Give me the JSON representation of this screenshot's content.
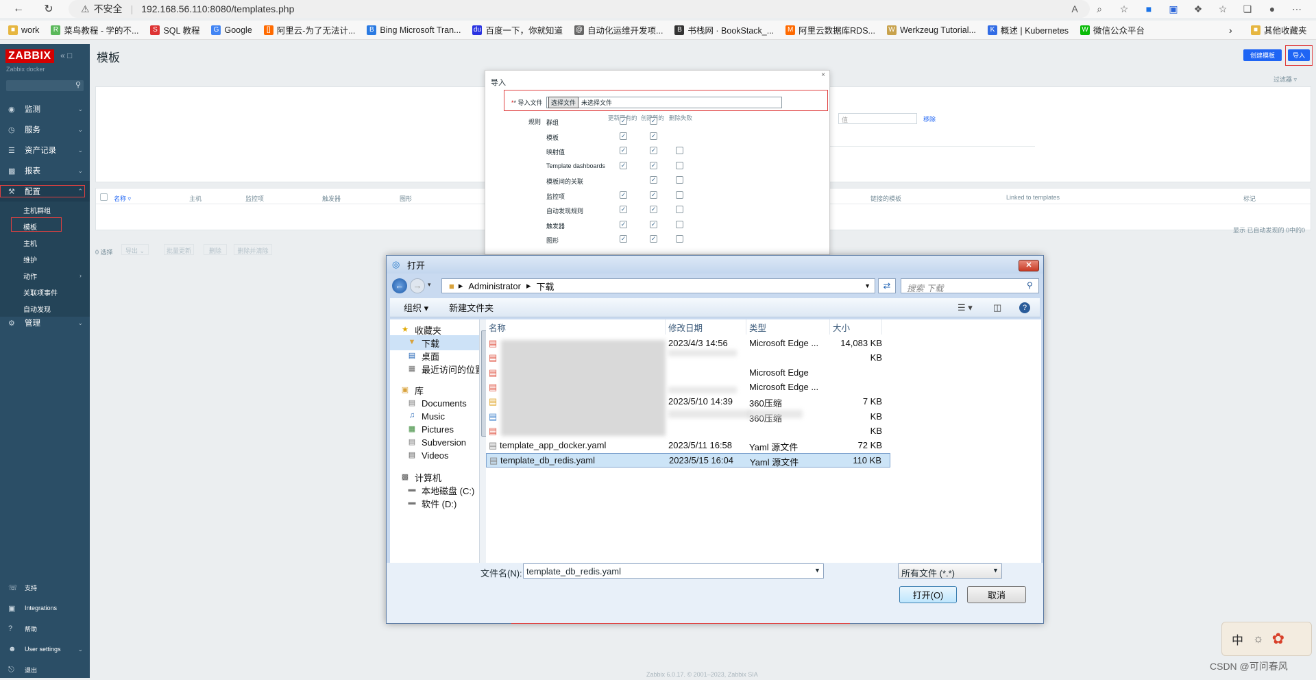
{
  "browser": {
    "insecure_label": "不安全",
    "url": "192.168.56.110:8080/templates.php",
    "bookmarks": [
      "work",
      "菜鸟教程 - 学的不...",
      "SQL 教程",
      "Google",
      "阿里云-为了无法计...",
      "Bing Microsoft Tran...",
      "百度一下，你就知道",
      "自动化运维开发项...",
      "书栈网 · BookStack_...",
      "阿里云数据库RDS...",
      "Werkzeug Tutorial...",
      "概述 | Kubernetes",
      "微信公众平台"
    ],
    "other_bookmarks": "其他收藏夹"
  },
  "sidebar": {
    "logo": "ZABBIX",
    "subtitle": "Zabbix docker",
    "menu": [
      "监测",
      "服务",
      "资产记录",
      "报表",
      "配置",
      "管理"
    ],
    "config_items": [
      "主机群组",
      "模板",
      "主机",
      "维护",
      "动作",
      "关联项事件",
      "自动发现"
    ],
    "bottom": [
      "支持",
      "Integrations",
      "帮助",
      "User settings",
      "退出"
    ]
  },
  "main": {
    "title": "模板",
    "create_button": "创建模板",
    "import_button": "导入",
    "filter_label": "过滤器",
    "value_placeholder": "值",
    "remove_link": "移除",
    "columns": [
      "名称",
      "主机",
      "监控项",
      "触发器",
      "图形",
      "链接的模板",
      "Linked to templates",
      "标记"
    ],
    "no_data_text": "显示 已自动发现的 0中的0",
    "selected_count": "0 选择",
    "bulk_buttons": [
      "导出",
      "批量更新",
      "删除",
      "删除并清除"
    ],
    "footer": "Zabbix 6.0.17. © 2001–2023, Zabbix SIA"
  },
  "import_modal": {
    "title": "导入",
    "file_label": "* 导入文件",
    "choose_file": "选择文件",
    "no_file": "未选择文件",
    "rules_label": "规则",
    "col_headers": [
      "更新现有的",
      "创建新的",
      "删除失败"
    ],
    "rules": [
      {
        "name": "群组",
        "update": true,
        "create": true,
        "delete": null
      },
      {
        "name": "模板",
        "update": true,
        "create": true,
        "delete": null
      },
      {
        "name": "映射值",
        "update": true,
        "create": true,
        "delete": false
      },
      {
        "name": "Template dashboards",
        "update": true,
        "create": true,
        "delete": false
      },
      {
        "name": "模板间的关联",
        "update": null,
        "create": true,
        "delete": false
      },
      {
        "name": "监控项",
        "update": true,
        "create": true,
        "delete": false
      },
      {
        "name": "自动发现规则",
        "update": true,
        "create": true,
        "delete": false
      },
      {
        "name": "触发器",
        "update": true,
        "create": true,
        "delete": false
      },
      {
        "name": "图形",
        "update": true,
        "create": true,
        "delete": false
      }
    ]
  },
  "file_dialog": {
    "title": "打开",
    "path": [
      "Administrator",
      "下载"
    ],
    "search_placeholder": "搜索 下载",
    "organize": "组织 ▾",
    "new_folder": "新建文件夹",
    "tree": {
      "favorites": "收藏夹",
      "fav_items": [
        "下载",
        "桌面",
        "最近访问的位置"
      ],
      "libraries": "库",
      "lib_items": [
        "Documents",
        "Music",
        "Pictures",
        "Subversion",
        "Videos"
      ],
      "computer": "计算机",
      "drives": [
        "本地磁盘 (C:)",
        "软件 (D:)"
      ]
    },
    "columns": [
      "名称",
      "修改日期",
      "类型",
      "大小"
    ],
    "rows": [
      {
        "name": "",
        "date": "2023/4/3 14:56",
        "type": "Microsoft Edge ...",
        "size": "14,083 KB"
      },
      {
        "name": "",
        "date": "",
        "type": "",
        "size": "KB"
      },
      {
        "name": "",
        "date": "",
        "type": "Microsoft Edge",
        "size": ""
      },
      {
        "name": "",
        "date": "",
        "type": "Microsoft Edge ...",
        "size": ""
      },
      {
        "name": "",
        "date": "2023/5/10 14:39",
        "type": "360压缩",
        "size": "7 KB"
      },
      {
        "name": "",
        "date": "",
        "type": "360压缩",
        "size": "KB"
      },
      {
        "name": "",
        "date": "",
        "type": "",
        "size": "KB"
      },
      {
        "name": "template_app_docker.yaml",
        "date": "2023/5/11 16:58",
        "type": "Yaml 源文件",
        "size": "72 KB"
      },
      {
        "name": "template_db_redis.yaml",
        "date": "2023/5/15 16:04",
        "type": "Yaml 源文件",
        "size": "110 KB"
      }
    ],
    "filename_label": "文件名(N):",
    "filename_value": "template_db_redis.yaml",
    "filter_value": "所有文件 (*.*)",
    "open_button": "打开(O)",
    "cancel_button": "取消"
  },
  "watermark": "CSDN @可问春风",
  "ime": "中"
}
